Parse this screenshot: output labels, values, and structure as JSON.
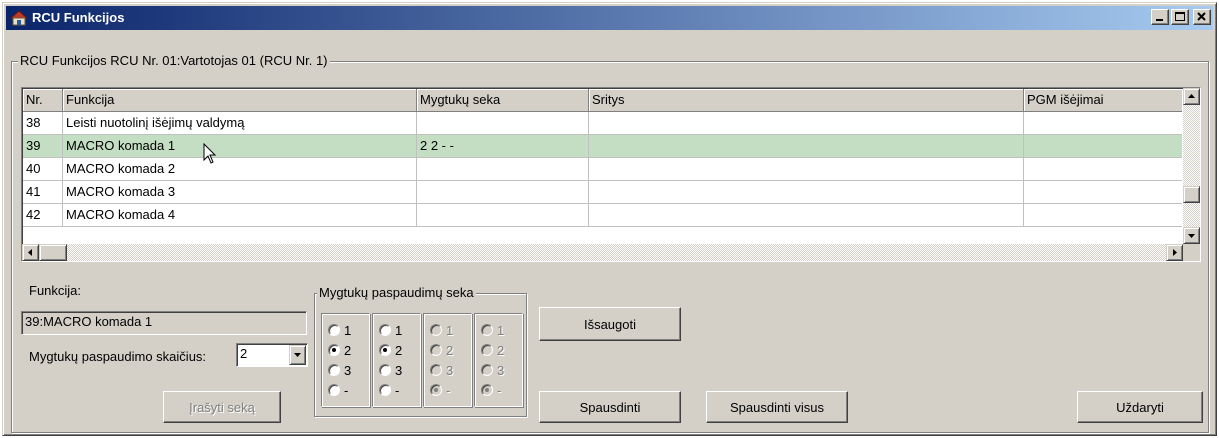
{
  "window": {
    "title": "RCU Funkcijos",
    "accent": "#0a246a"
  },
  "group": {
    "legend": "RCU Funkcijos RCU Nr.  01:Vartotojas 01 (RCU Nr. 1)"
  },
  "grid": {
    "headers": [
      "Nr.",
      "Funkcija",
      "Mygtukų seka",
      "Sritys",
      "PGM išėjimai"
    ],
    "rows": [
      {
        "nr": "38",
        "funkcija": "Leisti nuotolinį  išėjimų valdymą",
        "seka": "",
        "sritys": "",
        "pgm": ""
      },
      {
        "nr": "39",
        "funkcija": "MACRO komada 1",
        "seka": "2 2 - -",
        "sritys": "",
        "pgm": ""
      },
      {
        "nr": "40",
        "funkcija": "MACRO komada 2",
        "seka": "",
        "sritys": "",
        "pgm": ""
      },
      {
        "nr": "41",
        "funkcija": "MACRO komada 3",
        "seka": "",
        "sritys": "",
        "pgm": ""
      },
      {
        "nr": "42",
        "funkcija": "MACRO komada 4",
        "seka": "",
        "sritys": "",
        "pgm": ""
      }
    ],
    "selected_color": "#c3dec3"
  },
  "form": {
    "funkcija_label": "Funkcija:",
    "funkcija_value": "39:MACRO komada 1",
    "count_label": "Mygtukų paspaudimo skaičius:",
    "count_value": "2",
    "write_button": "Įrašyti seką"
  },
  "sequence": {
    "legend": "Mygtukų paspaudimų seka",
    "options": [
      "1",
      "2",
      "3",
      "-"
    ],
    "columns": [
      {
        "selected": "2",
        "enabled": true
      },
      {
        "selected": "2",
        "enabled": true
      },
      {
        "selected": "-",
        "enabled": false
      },
      {
        "selected": "-",
        "enabled": false
      }
    ]
  },
  "buttons": {
    "save": "Išsaugoti",
    "print": "Spausdinti",
    "print_all": "Spausdinti visus",
    "close": "Uždaryti"
  }
}
